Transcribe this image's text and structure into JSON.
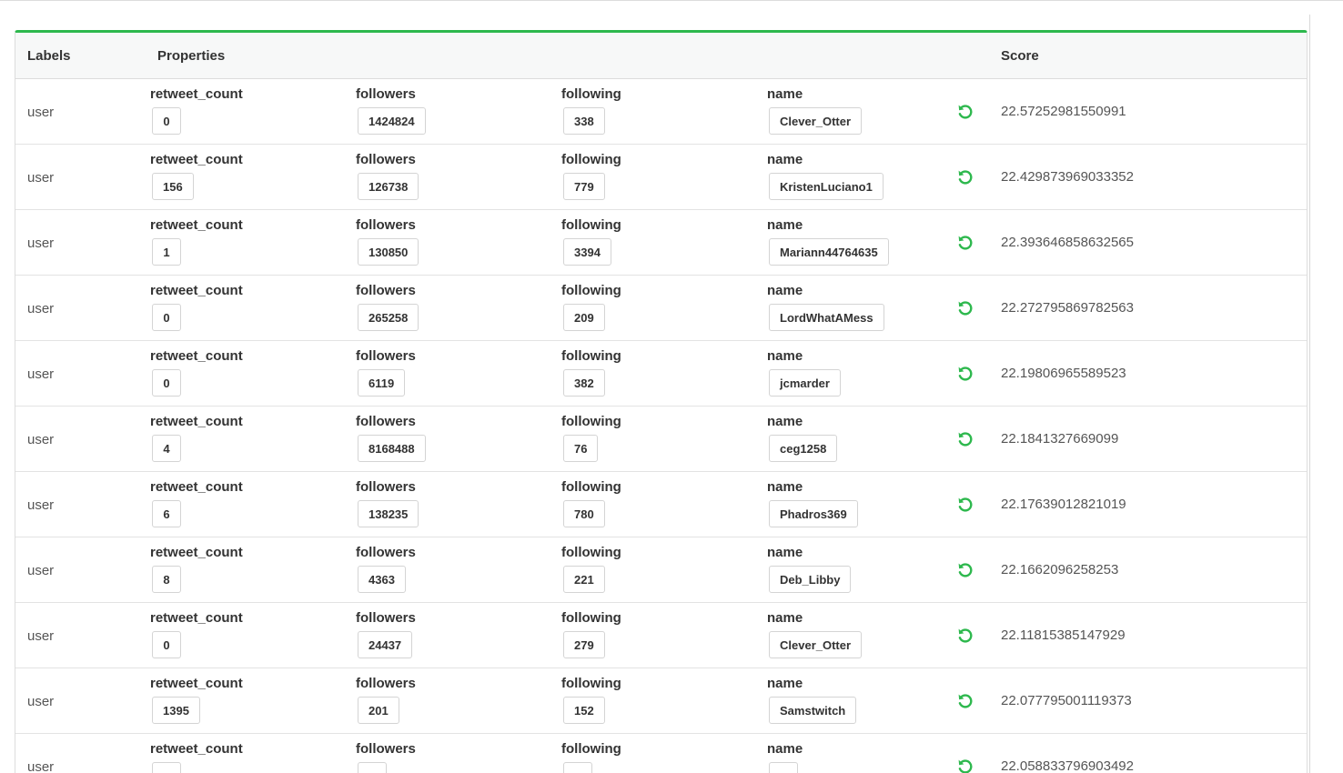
{
  "table": {
    "headers": {
      "labels": "Labels",
      "properties": "Properties",
      "score": "Score"
    },
    "icons": {
      "revert": "undo-icon",
      "accent_color": "#2db84d"
    },
    "rows": [
      {
        "label": "user",
        "props": [
          {
            "key": "retweet_count",
            "value": "0"
          },
          {
            "key": "followers",
            "value": "1424824"
          },
          {
            "key": "following",
            "value": "338"
          },
          {
            "key": "name",
            "value": "Clever_Otter"
          }
        ],
        "score": "22.57252981550991"
      },
      {
        "label": "user",
        "props": [
          {
            "key": "retweet_count",
            "value": "156"
          },
          {
            "key": "followers",
            "value": "126738"
          },
          {
            "key": "following",
            "value": "779"
          },
          {
            "key": "name",
            "value": "KristenLuciano1"
          }
        ],
        "score": "22.429873969033352"
      },
      {
        "label": "user",
        "props": [
          {
            "key": "retweet_count",
            "value": "1"
          },
          {
            "key": "followers",
            "value": "130850"
          },
          {
            "key": "following",
            "value": "3394"
          },
          {
            "key": "name",
            "value": "Mariann44764635"
          }
        ],
        "score": "22.393646858632565"
      },
      {
        "label": "user",
        "props": [
          {
            "key": "retweet_count",
            "value": "0"
          },
          {
            "key": "followers",
            "value": "265258"
          },
          {
            "key": "following",
            "value": "209"
          },
          {
            "key": "name",
            "value": "LordWhatAMess"
          }
        ],
        "score": "22.272795869782563"
      },
      {
        "label": "user",
        "props": [
          {
            "key": "retweet_count",
            "value": "0"
          },
          {
            "key": "followers",
            "value": "6119"
          },
          {
            "key": "following",
            "value": "382"
          },
          {
            "key": "name",
            "value": "jcmarder"
          }
        ],
        "score": "22.19806965589523"
      },
      {
        "label": "user",
        "props": [
          {
            "key": "retweet_count",
            "value": "4"
          },
          {
            "key": "followers",
            "value": "8168488"
          },
          {
            "key": "following",
            "value": "76"
          },
          {
            "key": "name",
            "value": "ceg1258"
          }
        ],
        "score": "22.1841327669099"
      },
      {
        "label": "user",
        "props": [
          {
            "key": "retweet_count",
            "value": "6"
          },
          {
            "key": "followers",
            "value": "138235"
          },
          {
            "key": "following",
            "value": "780"
          },
          {
            "key": "name",
            "value": "Phadros369"
          }
        ],
        "score": "22.17639012821019"
      },
      {
        "label": "user",
        "props": [
          {
            "key": "retweet_count",
            "value": "8"
          },
          {
            "key": "followers",
            "value": "4363"
          },
          {
            "key": "following",
            "value": "221"
          },
          {
            "key": "name",
            "value": "Deb_Libby"
          }
        ],
        "score": "22.1662096258253"
      },
      {
        "label": "user",
        "props": [
          {
            "key": "retweet_count",
            "value": "0"
          },
          {
            "key": "followers",
            "value": "24437"
          },
          {
            "key": "following",
            "value": "279"
          },
          {
            "key": "name",
            "value": "Clever_Otter"
          }
        ],
        "score": "22.11815385147929"
      },
      {
        "label": "user",
        "props": [
          {
            "key": "retweet_count",
            "value": "1395"
          },
          {
            "key": "followers",
            "value": "201"
          },
          {
            "key": "following",
            "value": "152"
          },
          {
            "key": "name",
            "value": "Samstwitch"
          }
        ],
        "score": "22.077795001119373"
      },
      {
        "label": "user",
        "props": [
          {
            "key": "retweet_count",
            "value": ""
          },
          {
            "key": "followers",
            "value": ""
          },
          {
            "key": "following",
            "value": ""
          },
          {
            "key": "name",
            "value": ""
          }
        ],
        "score": "22.058833796903492"
      }
    ]
  }
}
